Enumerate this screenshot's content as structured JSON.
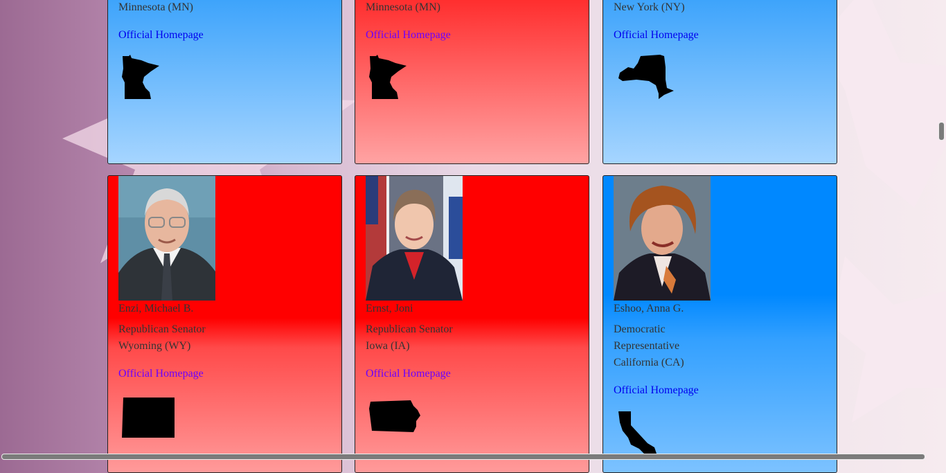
{
  "top_row": [
    {
      "state": "Minnesota (MN)",
      "link": "Official Homepage",
      "state_icon": "minnesota-shape-icon"
    },
    {
      "state": "Minnesota (MN)",
      "link": "Official Homepage",
      "state_icon": "minnesota-shape-icon"
    },
    {
      "state": "New York (NY)",
      "link": "Official Homepage",
      "state_icon": "new-york-shape-icon"
    }
  ],
  "bottom_row": [
    {
      "name": "Enzi, Michael B.",
      "role": "Republican Senator",
      "state": "Wyoming (WY)",
      "link": "Official Homepage",
      "state_icon": "wyoming-shape-icon",
      "party_color": "#ff0000"
    },
    {
      "name": "Ernst, Joni",
      "role": "Republican Senator",
      "state": "Iowa (IA)",
      "link": "Official Homepage",
      "state_icon": "iowa-shape-icon",
      "party_color": "#ff0000"
    },
    {
      "name": "Eshoo, Anna G.",
      "role_line1": "Democratic",
      "role_line2": "Representative",
      "state": "California (CA)",
      "link": "Official Homepage",
      "state_icon": "california-shape-icon",
      "party_color": "#0088ff"
    }
  ],
  "colors": {
    "democrat": "#3aa2fb",
    "republican": "#ff0000",
    "link": "#0000ee",
    "visited_link": "#6a00ff"
  }
}
